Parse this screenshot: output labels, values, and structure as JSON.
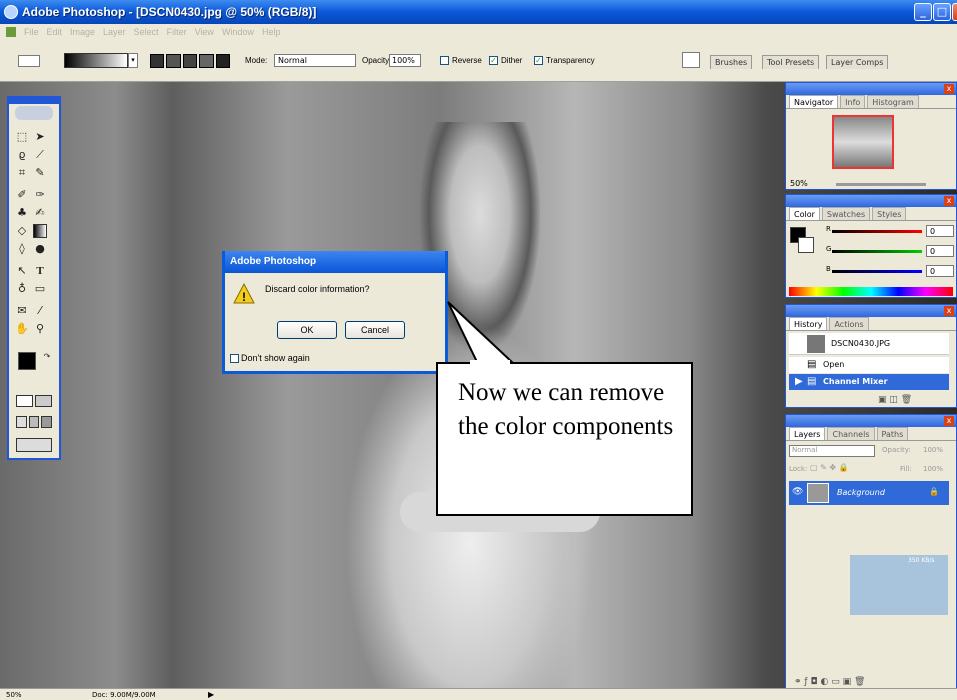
{
  "window": {
    "title": "Adobe Photoshop - [DSCN0430.jpg @ 50% (RGB/8)]",
    "minimize": "_",
    "maximize": "□",
    "close": "x"
  },
  "menu": [
    "File",
    "Edit",
    "Image",
    "Layer",
    "Select",
    "Filter",
    "View",
    "Window",
    "Help"
  ],
  "options": {
    "mode_label": "Mode:",
    "mode_value": "Normal",
    "opacity_label": "Opacity:",
    "opacity_value": "100%",
    "reverse": "Reverse",
    "dither": "Dither",
    "transparency": "Transparency",
    "well_tabs": [
      "Brushes",
      "Tool Presets",
      "Layer Comps"
    ]
  },
  "status": {
    "zoom": "50%",
    "doc": "Doc: 9.00M/9.00M"
  },
  "navigator": {
    "tabs": [
      "Navigator",
      "Info",
      "Histogram"
    ],
    "zoom": "50%"
  },
  "color": {
    "tabs": [
      "Color",
      "Swatches",
      "Styles"
    ],
    "r": {
      "label": "R",
      "value": "0"
    },
    "g": {
      "label": "G",
      "value": "0"
    },
    "b": {
      "label": "B",
      "value": "0"
    }
  },
  "history": {
    "tabs": [
      "History",
      "Actions"
    ],
    "snapshot": "DSCN0430.JPG",
    "items": [
      "Open",
      "Channel Mixer"
    ]
  },
  "layers": {
    "tabs": [
      "Layers",
      "Channels",
      "Paths"
    ],
    "blend": "Normal",
    "opacity_label": "Opacity:",
    "opacity": "100%",
    "lock_label": "Lock:",
    "fill_label": "Fill:",
    "fill": "100%",
    "layer_name": "Background",
    "size": "350 KB/s"
  },
  "dialog": {
    "title": "Adobe Photoshop",
    "message": "Discard color information?",
    "ok": "OK",
    "cancel": "Cancel",
    "dont_show": "Don't show again"
  },
  "callout": {
    "text": "Now we can remove the color components"
  },
  "colors": {
    "xp_blue": "#0a55d6",
    "panel_bg": "#ece9d8"
  }
}
